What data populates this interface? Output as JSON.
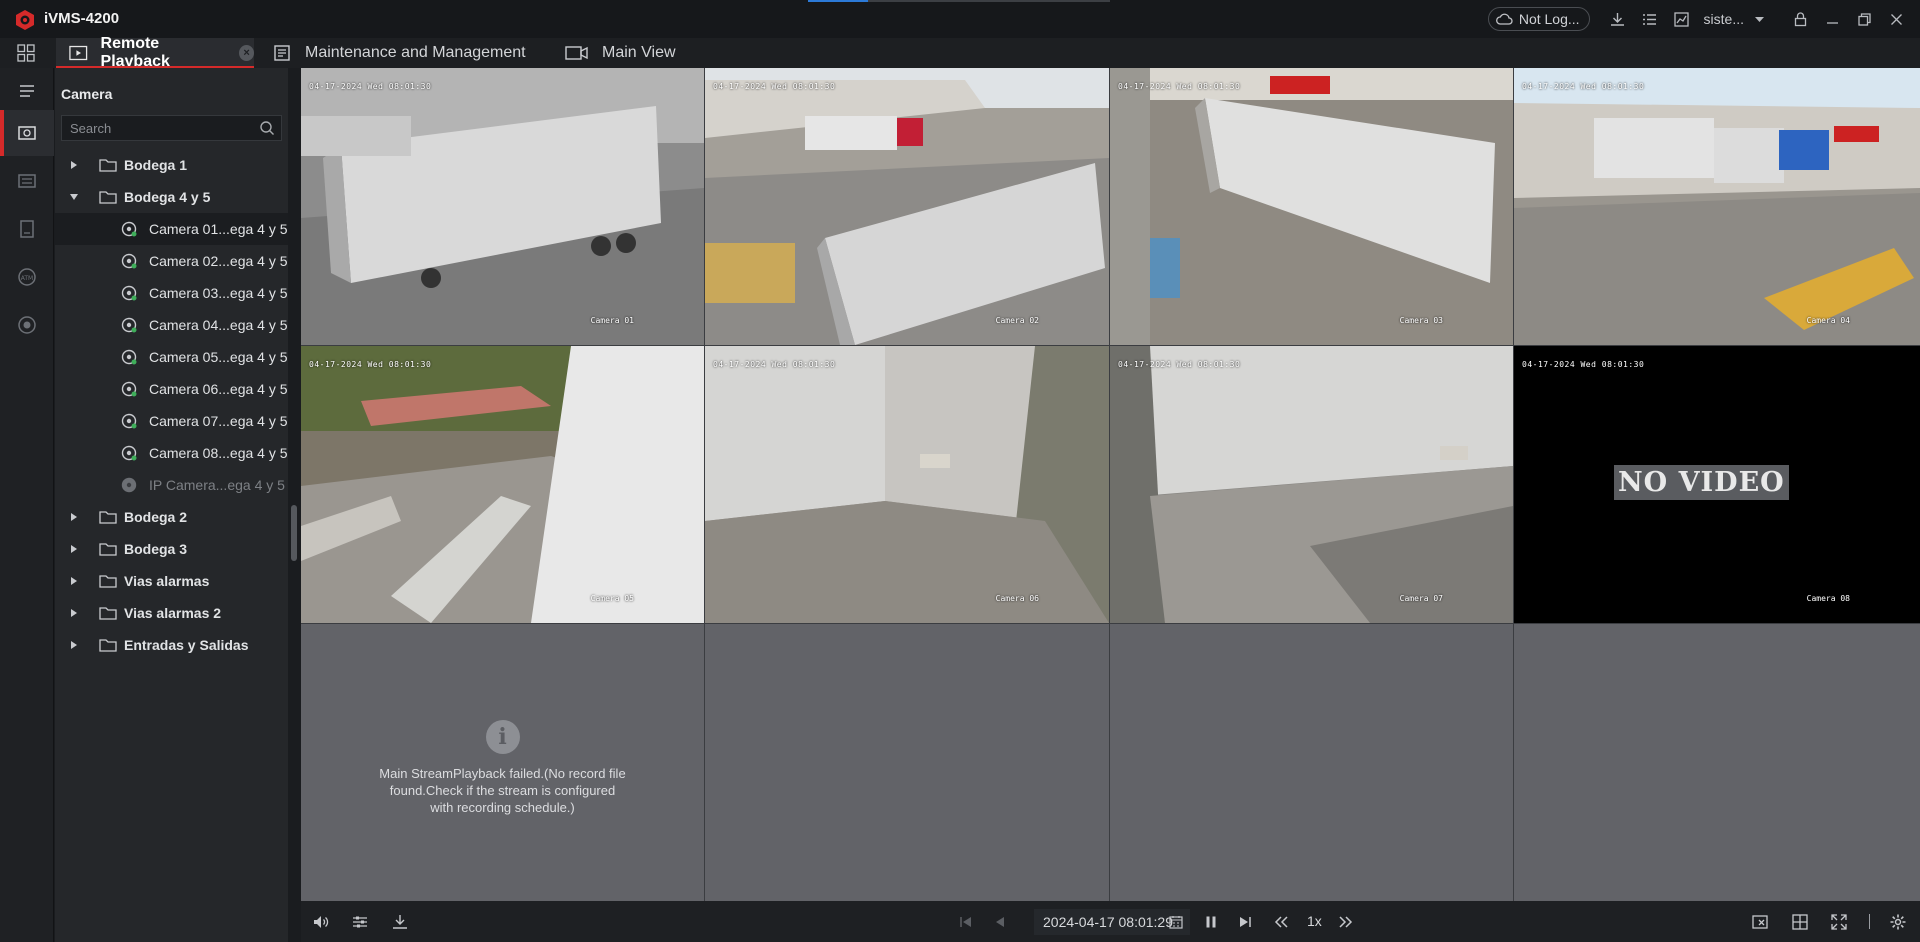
{
  "app": {
    "title": "iVMS-4200",
    "login_status": "Not Log...",
    "user": "siste..."
  },
  "tabs": [
    {
      "label": "Remote Playback",
      "active": true
    },
    {
      "label": "Maintenance and Management",
      "active": false
    },
    {
      "label": "Main View",
      "active": false
    }
  ],
  "panel": {
    "title": "Camera",
    "search_placeholder": "Search"
  },
  "tree": {
    "groups": [
      {
        "label": "Bodega 1",
        "expanded": false
      },
      {
        "label": "Bodega 4 y 5",
        "expanded": true
      },
      {
        "label": "Bodega 2",
        "expanded": false
      },
      {
        "label": "Bodega 3",
        "expanded": false
      },
      {
        "label": "Vias alarmas",
        "expanded": false
      },
      {
        "label": "Vias alarmas 2",
        "expanded": false
      },
      {
        "label": "Entradas y Salidas",
        "expanded": false
      }
    ],
    "cameras": [
      {
        "label": "Camera 01...ega 4 y 5",
        "selected": true
      },
      {
        "label": "Camera 02...ega 4 y 5"
      },
      {
        "label": "Camera 03...ega 4 y 5"
      },
      {
        "label": "Camera 04...ega 4 y 5"
      },
      {
        "label": "Camera 05...ega 4 y 5"
      },
      {
        "label": "Camera 06...ega 4 y 5"
      },
      {
        "label": "Camera 07...ega 4 y 5"
      },
      {
        "label": "Camera 08...ega 4 y 5"
      },
      {
        "label": "IP Camera...ega 4 y 5",
        "offline": true
      }
    ]
  },
  "tiles": [
    {
      "timestamp": "04-17-2024 Wed 08:01:30",
      "camera": "Camera 01"
    },
    {
      "timestamp": "04-17-2024 Wed 08:01:30",
      "camera": "Camera 02"
    },
    {
      "timestamp": "04-17-2024 Wed 08:01:30",
      "camera": "Camera 03"
    },
    {
      "timestamp": "04-17-2024 Wed 08:01:30",
      "camera": "Camera 04"
    },
    {
      "timestamp": "04-17-2024 Wed 08:01:30",
      "camera": "Camera 05"
    },
    {
      "timestamp": "04-17-2024 Wed 08:01:30",
      "camera": "Camera 06"
    },
    {
      "timestamp": "04-17-2024 Wed 08:01:30",
      "camera": "Camera 07"
    },
    {
      "timestamp": "04-17-2024 Wed 08:01:30",
      "camera": "Camera 08",
      "overlay": "NO VIDEO"
    }
  ],
  "empty_tile": {
    "message": "Main StreamPlayback failed.(No record file found.Check if the stream is configured with recording schedule.)"
  },
  "playback": {
    "time": "2024-04-17 08:01:29",
    "speed": "1x"
  },
  "icons": {
    "titlebar": [
      "cloud-icon",
      "download-icon",
      "list-icon",
      "chart-icon",
      "dropdown-icon",
      "lock-icon",
      "minimize-icon",
      "restore-icon",
      "close-icon"
    ],
    "rail": [
      "menu-icon",
      "remote-playback-icon",
      "event-icon",
      "device-icon",
      "atm-icon",
      "record-icon"
    ]
  },
  "colors": {
    "accent_red": "#d52a2a",
    "accent_blue": "#2c7ad8",
    "background": "#1a1c1f"
  }
}
